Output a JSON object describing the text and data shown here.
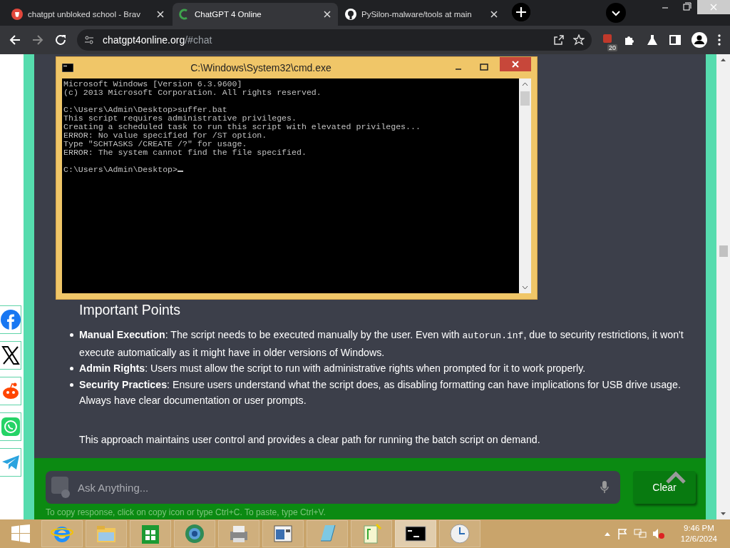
{
  "browser": {
    "tabs": [
      {
        "title": "chatgpt unbloked school - Brav",
        "selected": false
      },
      {
        "title": "ChatGPT 4 Online",
        "selected": true
      },
      {
        "title": "PySilon-malware/tools at main",
        "selected": false
      }
    ],
    "address": {
      "host": "chatgpt4online.org",
      "path": "/#chat"
    },
    "extension_badge": "20"
  },
  "console": {
    "title": "C:\\Windows\\System32\\cmd.exe",
    "blocks": [
      [
        "Microsoft Windows [Version 6.3.9600]",
        "(c) 2013 Microsoft Corporation. All rights reserved."
      ],
      [
        "C:\\Users\\Admin\\Desktop>suffer.bat",
        "This script requires administrative privileges.",
        "Creating a scheduled task to run this script with elevated privileges...",
        "ERROR: No value specified for /ST option.",
        "Type \"SCHTASKS /CREATE /?\" for usage.",
        "ERROR: The system cannot find the file specified."
      ],
      [
        "C:\\Users\\Admin\\Desktop>"
      ]
    ]
  },
  "article": {
    "heading": "Important Points",
    "bullets": [
      {
        "segments": [
          {
            "kind": "bold",
            "text": "Manual Execution"
          },
          {
            "kind": "text",
            "text": ": The script needs to be executed manually by the user. Even with "
          },
          {
            "kind": "code",
            "text": "autorun.inf"
          },
          {
            "kind": "text",
            "text": ", due to security restrictions, it won't execute automatically as it might have in older versions of Windows."
          }
        ]
      },
      {
        "segments": [
          {
            "kind": "bold",
            "text": "Admin Rights"
          },
          {
            "kind": "text",
            "text": ": Users must allow the script to run with administrative rights when prompted for it to work properly."
          }
        ]
      },
      {
        "segments": [
          {
            "kind": "bold",
            "text": "Security Practices"
          },
          {
            "kind": "text",
            "text": ": Ensure users understand what the script does, as disabling formatting can have implications for USB drive usage. Always have clear documentation or user prompts."
          }
        ]
      }
    ],
    "closing": "This approach maintains user control and provides a clear path for running the batch script on demand."
  },
  "social": [
    {
      "kind": "facebook"
    },
    {
      "kind": "x"
    },
    {
      "kind": "reddit"
    },
    {
      "kind": "whatsapp"
    },
    {
      "kind": "telegram"
    }
  ],
  "chat": {
    "placeholder": "Ask Anything...",
    "button": "Clear",
    "hint": "To copy response, click on copy icon or type Ctrl+C. To paste, type Ctrl+V."
  },
  "taskbar": {
    "apps": [
      {
        "kind": "ie",
        "selected": false
      },
      {
        "kind": "folder",
        "selected": false
      },
      {
        "kind": "store",
        "selected": false
      },
      {
        "kind": "globe",
        "selected": false
      },
      {
        "kind": "printer",
        "selected": false
      },
      {
        "kind": "window",
        "selected": false
      },
      {
        "kind": "notepad",
        "selected": false
      },
      {
        "kind": "notepadpp",
        "selected": false
      },
      {
        "kind": "console",
        "selected": true
      },
      {
        "kind": "clock",
        "selected": false
      }
    ],
    "time": "9:46 PM",
    "date": "12/6/2024"
  }
}
